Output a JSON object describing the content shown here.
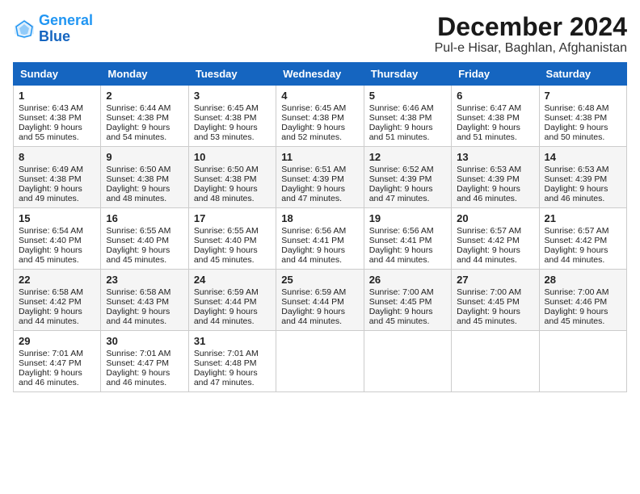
{
  "logo": {
    "line1": "General",
    "line2": "Blue"
  },
  "title": "December 2024",
  "location": "Pul-e Hisar, Baghlan, Afghanistan",
  "days_of_week": [
    "Sunday",
    "Monday",
    "Tuesday",
    "Wednesday",
    "Thursday",
    "Friday",
    "Saturday"
  ],
  "weeks": [
    [
      {
        "day": 1,
        "sunrise": "6:43 AM",
        "sunset": "4:38 PM",
        "daylight": "9 hours and 55 minutes."
      },
      {
        "day": 2,
        "sunrise": "6:44 AM",
        "sunset": "4:38 PM",
        "daylight": "9 hours and 54 minutes."
      },
      {
        "day": 3,
        "sunrise": "6:45 AM",
        "sunset": "4:38 PM",
        "daylight": "9 hours and 53 minutes."
      },
      {
        "day": 4,
        "sunrise": "6:45 AM",
        "sunset": "4:38 PM",
        "daylight": "9 hours and 52 minutes."
      },
      {
        "day": 5,
        "sunrise": "6:46 AM",
        "sunset": "4:38 PM",
        "daylight": "9 hours and 51 minutes."
      },
      {
        "day": 6,
        "sunrise": "6:47 AM",
        "sunset": "4:38 PM",
        "daylight": "9 hours and 51 minutes."
      },
      {
        "day": 7,
        "sunrise": "6:48 AM",
        "sunset": "4:38 PM",
        "daylight": "9 hours and 50 minutes."
      }
    ],
    [
      {
        "day": 8,
        "sunrise": "6:49 AM",
        "sunset": "4:38 PM",
        "daylight": "9 hours and 49 minutes."
      },
      {
        "day": 9,
        "sunrise": "6:50 AM",
        "sunset": "4:38 PM",
        "daylight": "9 hours and 48 minutes."
      },
      {
        "day": 10,
        "sunrise": "6:50 AM",
        "sunset": "4:38 PM",
        "daylight": "9 hours and 48 minutes."
      },
      {
        "day": 11,
        "sunrise": "6:51 AM",
        "sunset": "4:39 PM",
        "daylight": "9 hours and 47 minutes."
      },
      {
        "day": 12,
        "sunrise": "6:52 AM",
        "sunset": "4:39 PM",
        "daylight": "9 hours and 47 minutes."
      },
      {
        "day": 13,
        "sunrise": "6:53 AM",
        "sunset": "4:39 PM",
        "daylight": "9 hours and 46 minutes."
      },
      {
        "day": 14,
        "sunrise": "6:53 AM",
        "sunset": "4:39 PM",
        "daylight": "9 hours and 46 minutes."
      }
    ],
    [
      {
        "day": 15,
        "sunrise": "6:54 AM",
        "sunset": "4:40 PM",
        "daylight": "9 hours and 45 minutes."
      },
      {
        "day": 16,
        "sunrise": "6:55 AM",
        "sunset": "4:40 PM",
        "daylight": "9 hours and 45 minutes."
      },
      {
        "day": 17,
        "sunrise": "6:55 AM",
        "sunset": "4:40 PM",
        "daylight": "9 hours and 45 minutes."
      },
      {
        "day": 18,
        "sunrise": "6:56 AM",
        "sunset": "4:41 PM",
        "daylight": "9 hours and 44 minutes."
      },
      {
        "day": 19,
        "sunrise": "6:56 AM",
        "sunset": "4:41 PM",
        "daylight": "9 hours and 44 minutes."
      },
      {
        "day": 20,
        "sunrise": "6:57 AM",
        "sunset": "4:42 PM",
        "daylight": "9 hours and 44 minutes."
      },
      {
        "day": 21,
        "sunrise": "6:57 AM",
        "sunset": "4:42 PM",
        "daylight": "9 hours and 44 minutes."
      }
    ],
    [
      {
        "day": 22,
        "sunrise": "6:58 AM",
        "sunset": "4:42 PM",
        "daylight": "9 hours and 44 minutes."
      },
      {
        "day": 23,
        "sunrise": "6:58 AM",
        "sunset": "4:43 PM",
        "daylight": "9 hours and 44 minutes."
      },
      {
        "day": 24,
        "sunrise": "6:59 AM",
        "sunset": "4:44 PM",
        "daylight": "9 hours and 44 minutes."
      },
      {
        "day": 25,
        "sunrise": "6:59 AM",
        "sunset": "4:44 PM",
        "daylight": "9 hours and 44 minutes."
      },
      {
        "day": 26,
        "sunrise": "7:00 AM",
        "sunset": "4:45 PM",
        "daylight": "9 hours and 45 minutes."
      },
      {
        "day": 27,
        "sunrise": "7:00 AM",
        "sunset": "4:45 PM",
        "daylight": "9 hours and 45 minutes."
      },
      {
        "day": 28,
        "sunrise": "7:00 AM",
        "sunset": "4:46 PM",
        "daylight": "9 hours and 45 minutes."
      }
    ],
    [
      {
        "day": 29,
        "sunrise": "7:01 AM",
        "sunset": "4:47 PM",
        "daylight": "9 hours and 46 minutes."
      },
      {
        "day": 30,
        "sunrise": "7:01 AM",
        "sunset": "4:47 PM",
        "daylight": "9 hours and 46 minutes."
      },
      {
        "day": 31,
        "sunrise": "7:01 AM",
        "sunset": "4:48 PM",
        "daylight": "9 hours and 47 minutes."
      },
      null,
      null,
      null,
      null
    ]
  ]
}
